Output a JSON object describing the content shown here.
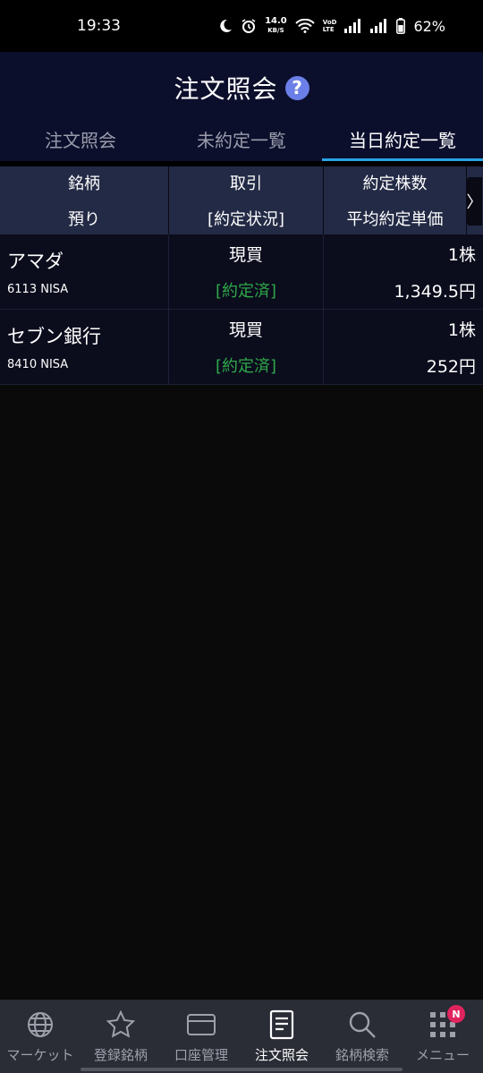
{
  "status_bar": {
    "time": "19:33",
    "net_speed": "14.0",
    "net_unit": "KB/S",
    "volte_1": "VoD",
    "volte_2": "LTE",
    "battery": "62%"
  },
  "header": {
    "title": "注文照会",
    "help": "?"
  },
  "tabs": [
    {
      "label": "注文照会",
      "active": false
    },
    {
      "label": "未約定一覧",
      "active": false
    },
    {
      "label": "当日約定一覧",
      "active": true
    }
  ],
  "table": {
    "headers": {
      "col1_top": "銘柄",
      "col1_bottom": "預り",
      "col2_top": "取引",
      "col2_bottom": "[約定状況]",
      "col3_top": "約定株数",
      "col3_bottom": "平均約定単価"
    },
    "rows": [
      {
        "name": "アマダ",
        "code": "6113 NISA",
        "trade": "現買",
        "status": "[約定済]",
        "qty": "1株",
        "price": "1,349.5円"
      },
      {
        "name": "セブン銀行",
        "code": "8410 NISA",
        "trade": "現買",
        "status": "[約定済]",
        "qty": "1株",
        "price": "252円"
      }
    ],
    "next_arrow": "〉"
  },
  "bottom_nav": [
    {
      "label": "マーケット",
      "icon": "globe-icon"
    },
    {
      "label": "登録銘柄",
      "icon": "star-icon"
    },
    {
      "label": "口座管理",
      "icon": "card-icon"
    },
    {
      "label": "注文照会",
      "icon": "document-icon",
      "active": true
    },
    {
      "label": "銘柄検索",
      "icon": "search-icon"
    },
    {
      "label": "メニュー",
      "icon": "grid-menu-icon",
      "badge": "N"
    }
  ],
  "colors": {
    "header_bg": "#0c0f2c",
    "tab_active_underline": "#27a3e6",
    "status_done": "#2fa84a",
    "badge": "#e0245e",
    "help_icon": "#6b7fe8"
  }
}
